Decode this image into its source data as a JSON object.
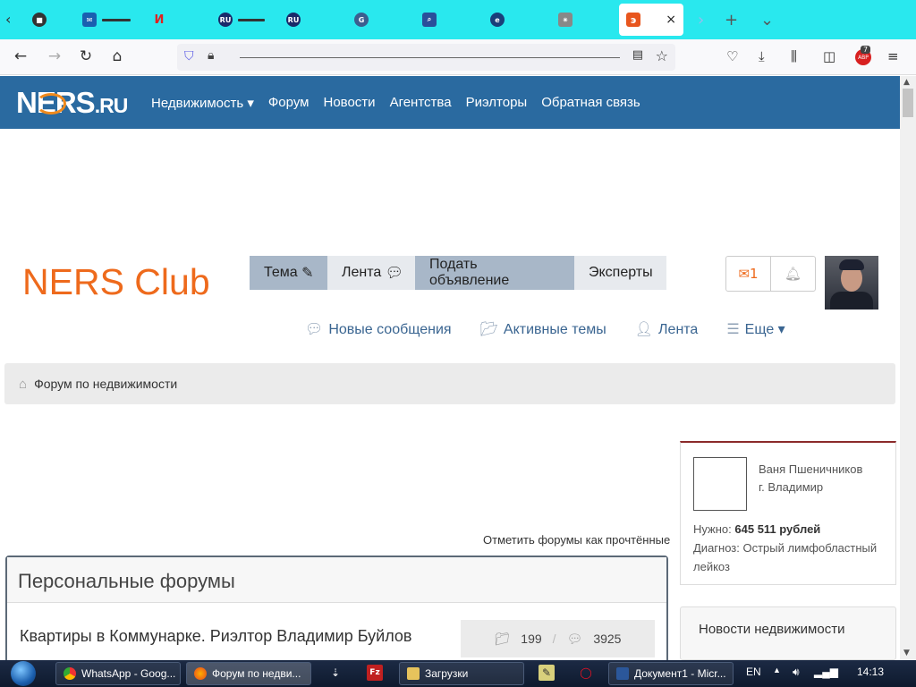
{
  "browser": {
    "active_tab_close": "×",
    "new_tab": "+",
    "tab_list": "⌄",
    "addon_badge": "7",
    "addon_label": "ABP"
  },
  "site": {
    "logo_main": "NERS",
    "logo_suffix": ".RU",
    "menu": [
      "Недвижимость ▾",
      "Форум",
      "Новости",
      "Агентства",
      "Риэлторы",
      "Обратная связь"
    ]
  },
  "club": {
    "title": "NERS Club",
    "buttons": {
      "tema": "Тема",
      "lenta": "Лента",
      "podat": "Подать объявление",
      "experts": "Эксперты"
    },
    "messages_count": "1"
  },
  "subnav": {
    "new_messages": "Новые сообщения",
    "active_topics": "Активные темы",
    "feed": "Лента",
    "more": "Еще ▾"
  },
  "breadcrumb": {
    "label": "Форум по недвижимости"
  },
  "forum": {
    "mark_read": "Отметить форумы как прочтённые",
    "section_title": "Персональные форумы",
    "row_title": "Квартиры в Коммунарке. Риэлтор Владимир Буйлов",
    "topics": "199",
    "posts": "3925"
  },
  "sidebar": {
    "person_name": "Ваня Пшеничников",
    "person_city": "г. Владимир",
    "need_label": "Нужно:",
    "need_value": "645 511 рублей",
    "diagnosis": "Диагноз: Острый лимфобластный лейкоз",
    "news_title": "Новости недвижимости"
  },
  "taskbar": {
    "items": [
      "WhatsApp - Goog...",
      "Форум по недви...",
      "Загрузки",
      "Документ1 - Micr..."
    ],
    "lang": "EN",
    "time": "14:13"
  },
  "colors": {
    "tabbar": "#29e8ee",
    "site_nav": "#2a6aa0",
    "club_title": "#ee6a1c",
    "link": "#3a6591"
  }
}
